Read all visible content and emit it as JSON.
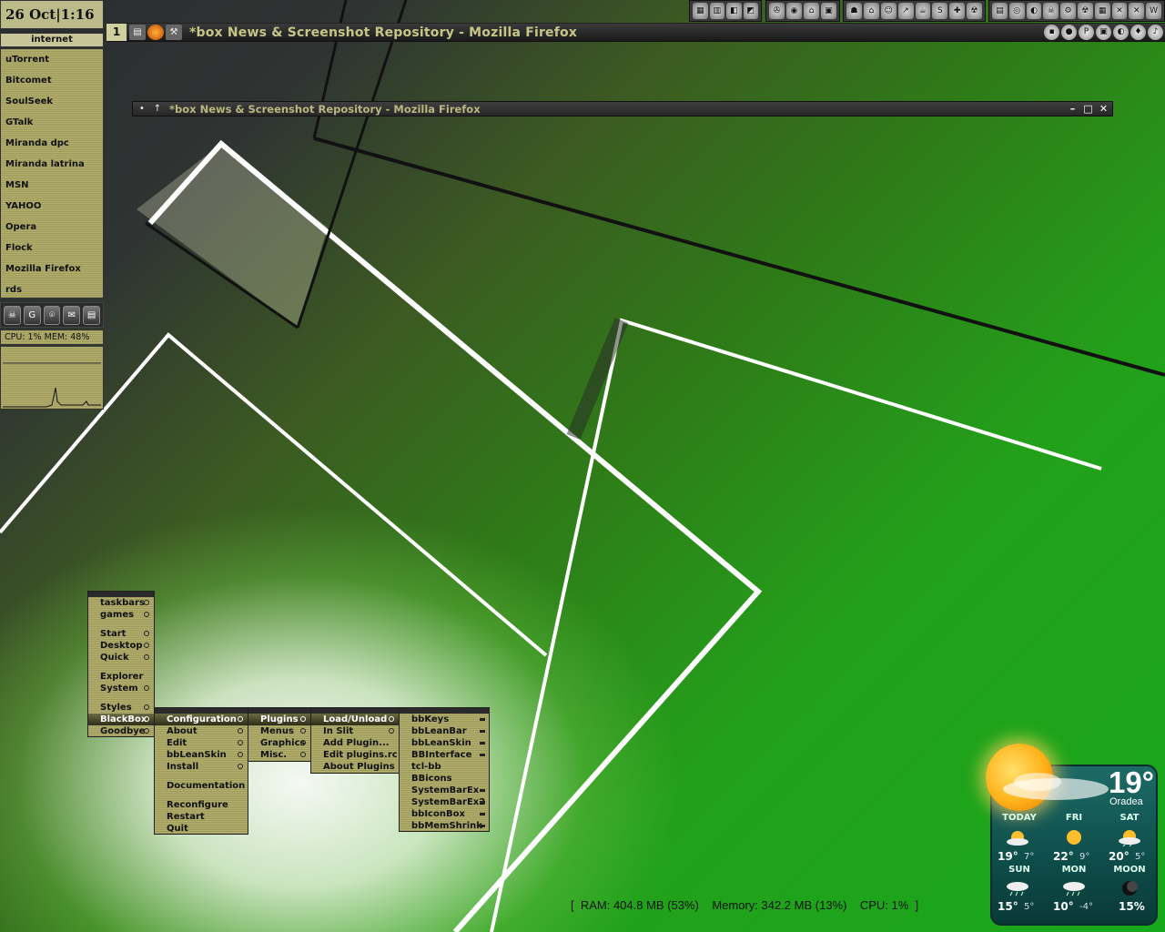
{
  "clock": "26 Oct|1:16",
  "left_menu": {
    "title": "internet",
    "items": [
      "uTorrent",
      "Bitcomet",
      "SoulSeek",
      "GTalk",
      "Miranda dpc",
      "Miranda latrina",
      "MSN",
      "YAHOO",
      "Opera",
      "Flock",
      "Mozilla Firefox",
      "rds"
    ]
  },
  "system_stats": {
    "cpu_mem": "CPU: 1%   MEM: 48%"
  },
  "taskbar": {
    "workspace": "1",
    "title": "*box News & Screenshot Repository - Mozilla Firefox"
  },
  "window": {
    "title": "*box News & Screenshot Repository - Mozilla Firefox"
  },
  "main_menu": {
    "items": [
      "taskbars",
      "games",
      "Start",
      "Desktop",
      "Quick",
      "Explorer",
      "System",
      "Styles",
      "BlackBox",
      "Goodbye"
    ]
  },
  "blackbox_menu": {
    "items": [
      "Configuration",
      "About",
      "Edit",
      "bbLeanSkin",
      "Install",
      "Documentation",
      "Reconfigure",
      "Restart",
      "Quit"
    ]
  },
  "config_menu": {
    "items": [
      "Plugins",
      "Menus",
      "Graphics",
      "Misc."
    ]
  },
  "plugins_menu": {
    "items": [
      "Load/Unload",
      "In Slit",
      "Add Plugin...",
      "Edit plugins.rc",
      "About Plugins"
    ]
  },
  "load_menu": {
    "items": [
      "bbKeys",
      "bbLeanBar",
      "bbLeanSkin",
      "BBInterface",
      "tcl-bb",
      "BBicons",
      "SystemBarEx",
      "SystemBarEx2",
      "bbIconBox",
      "bbMemShrink"
    ]
  },
  "memory_line": "[  RAM: 404.8 MB (53%)    Memory: 342.2 MB (13%)    CPU: 1%  ]",
  "weather": {
    "temp": "19°",
    "city": "Oradea",
    "days": [
      {
        "label": "TODAY",
        "hi": "19°",
        "lo": "7°"
      },
      {
        "label": "FRI",
        "hi": "22°",
        "lo": "9°"
      },
      {
        "label": "SAT",
        "hi": "20°",
        "lo": "5°"
      },
      {
        "label": "SUN",
        "hi": "15°",
        "lo": "5°"
      },
      {
        "label": "MON",
        "hi": "10°",
        "lo": "-4°"
      },
      {
        "label": "MOON",
        "hi": "15%",
        "lo": ""
      }
    ]
  },
  "colors": {
    "accent": "#b3b06e",
    "title_text": "#c6c688",
    "weather_bg": "#0e4d4a"
  }
}
